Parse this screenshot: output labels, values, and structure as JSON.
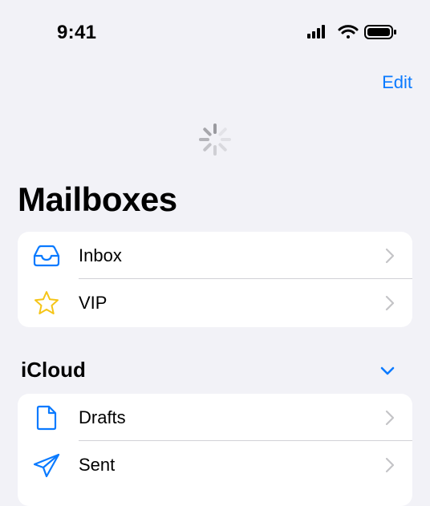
{
  "status": {
    "time": "9:41"
  },
  "nav": {
    "edit_label": "Edit"
  },
  "title": "Mailboxes",
  "mailboxes": [
    {
      "label": "Inbox",
      "icon": "inbox-tray-icon"
    },
    {
      "label": "VIP",
      "icon": "star-icon"
    }
  ],
  "account": {
    "name": "iCloud",
    "items": [
      {
        "label": "Drafts",
        "icon": "document-icon"
      },
      {
        "label": "Sent",
        "icon": "paper-plane-icon"
      }
    ]
  },
  "colors": {
    "accent": "#0A7AFF",
    "vip": "#F5C518",
    "background": "#F2F2F7"
  }
}
